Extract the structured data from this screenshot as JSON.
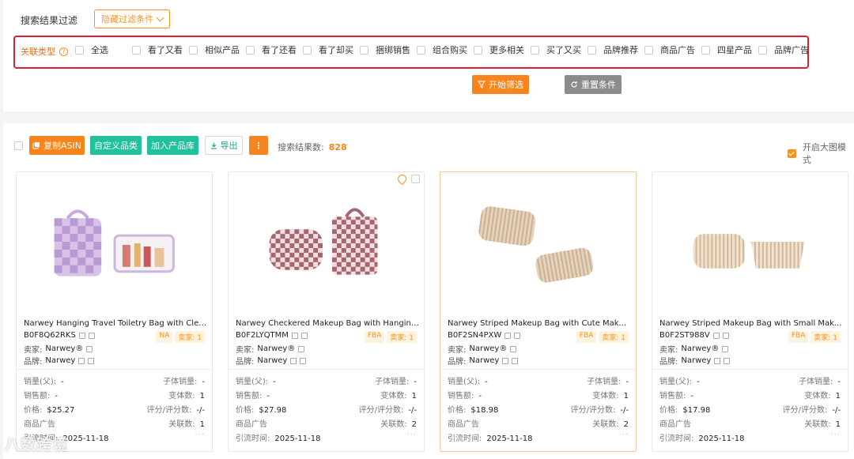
{
  "filter": {
    "title": "搜索结果过滤",
    "hide_button": "隐藏过滤条件",
    "assoc_label": "关联类型",
    "options": [
      "全选",
      "看了又看",
      "相似产品",
      "看了还看",
      "看了却买",
      "捆绑销售",
      "组合购买",
      "更多相关",
      "买了又买",
      "品牌推荐",
      "商品广告",
      "四星产品",
      "品牌广告"
    ],
    "start_button": "开始筛选",
    "reset_button": "重置条件"
  },
  "toolbar": {
    "copy_asin": "复制ASIN",
    "custom_category": "自定义品类",
    "add_library": "加入产品库",
    "export": "导出",
    "more": "⋮",
    "result_label": "搜索结果数:",
    "result_count": "828",
    "big_mode": "开启大图模式"
  },
  "labels": {
    "seller": "卖家:",
    "brand": "品牌:",
    "sales_parent": "销量(父):",
    "sub_sales": "子体销量:",
    "revenue": "销售额:",
    "variants": "变体数:",
    "price": "价格:",
    "rating": "评分/评分数:",
    "ad": "商品广告",
    "related": "关联数:",
    "traffic_time": "引流时间:"
  },
  "cards": [
    {
      "title": "Narwey Hanging Travel Toiletry Bag with Clear Makeup Pouch",
      "asin": "B0F8Q62RKS",
      "badge1": "NA",
      "badge2": "卖家: 1",
      "seller": "Narwey®",
      "brand": "Narwey",
      "sales_parent": "-",
      "sub_sales": "-",
      "revenue": "-",
      "variants": "1",
      "price": "$25.27",
      "rating": "-/-",
      "related": "1",
      "traffic_time": "2025-11-18",
      "dots": "···"
    },
    {
      "title": "Narwey Checkered Makeup Bag with Hanging Toiletry Bag",
      "asin": "B0F2LYQTMM",
      "badge1": "FBA",
      "badge2": "卖家: 1",
      "seller": "Narwey®",
      "brand": "Narwey",
      "sales_parent": "-",
      "sub_sales": "-",
      "revenue": "-",
      "variants": "1",
      "price": "$27.98",
      "rating": "-/-",
      "related": "2",
      "traffic_time": "2025-11-18",
      "dots": "···"
    },
    {
      "title": "Narwey Striped Makeup Bag with Cute Makeup Pouch",
      "asin": "B0F2SN4PXW",
      "badge1": "FBA",
      "badge2": "卖家: 1",
      "seller": "Narwey®",
      "brand": "Narwey",
      "sales_parent": "-",
      "sub_sales": "-",
      "revenue": "-",
      "variants": "1",
      "price": "$18.98",
      "rating": "-/-",
      "related": "2",
      "traffic_time": "2025-11-18",
      "dots": "···"
    },
    {
      "title": "Narwey Striped Makeup Bag with Small Makeup Pouch",
      "asin": "B0F2ST988V",
      "badge1": "FBA",
      "badge2": "卖家: 1",
      "seller": "Narwey®",
      "brand": "Narwey",
      "sales_parent": "-",
      "sub_sales": "-",
      "revenue": "-",
      "variants": "1",
      "price": "$17.98",
      "rating": "-/-",
      "related": "1",
      "traffic_time": "2025-11-18",
      "dots": "···"
    }
  ],
  "watermark": "八数跨境"
}
